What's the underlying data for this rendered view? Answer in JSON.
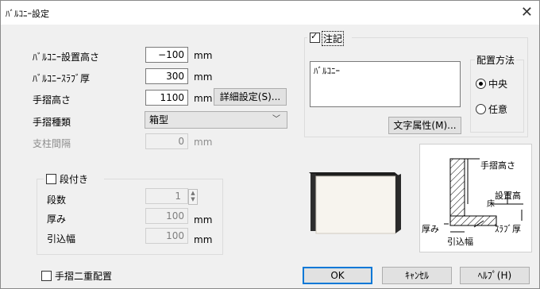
{
  "window": {
    "title": "ﾊﾞﾙｺﾆｰ設定",
    "close_icon": "close-icon"
  },
  "fields": {
    "height_label": "ﾊﾞﾙｺﾆｰ設置高さ",
    "height_value": "−100",
    "height_unit": "mm",
    "slab_label": "ﾊﾞﾙｺﾆｰｽﾗﾌﾞ厚",
    "slab_value": "300",
    "slab_unit": "mm",
    "rail_height_label": "手摺高さ",
    "rail_height_value": "1100",
    "rail_height_unit": "mm",
    "detail_button": "詳細設定(S)...",
    "rail_type_label": "手摺種類",
    "rail_type_value": "箱型",
    "post_label": "支柱間隔",
    "post_value": "0",
    "post_unit": "mm"
  },
  "step_group": {
    "checkbox_label": "段付き",
    "count_label": "段数",
    "count_value": "1",
    "thickness_label": "厚み",
    "thickness_value": "100",
    "thickness_unit": "mm",
    "setback_label": "引込幅",
    "setback_value": "100",
    "setback_unit": "mm"
  },
  "double_rail_label": "手摺二重配置",
  "annotation": {
    "checkbox_label": "注記",
    "checked": true,
    "text": "ﾊﾞﾙｺﾆｰ",
    "font_button": "文字属性(M)...",
    "placement_title": "配置方法",
    "options": [
      "中央",
      "任意"
    ],
    "selected": "中央"
  },
  "diagram_labels": {
    "rail_height": "手摺高さ",
    "install_height": "設置高",
    "floor": "床",
    "thickness": "厚み",
    "slab": "ｽﾗﾌﾞ厚",
    "setback": "引込幅"
  },
  "buttons": {
    "ok": "OK",
    "cancel": "ｷｬﾝｾﾙ",
    "help": "ﾍﾙﾌﾟ(H)"
  },
  "colors": {
    "accent": "#0078d7",
    "preview_dark": "#3a3a3a",
    "preview_face": "#f7f4ee"
  }
}
